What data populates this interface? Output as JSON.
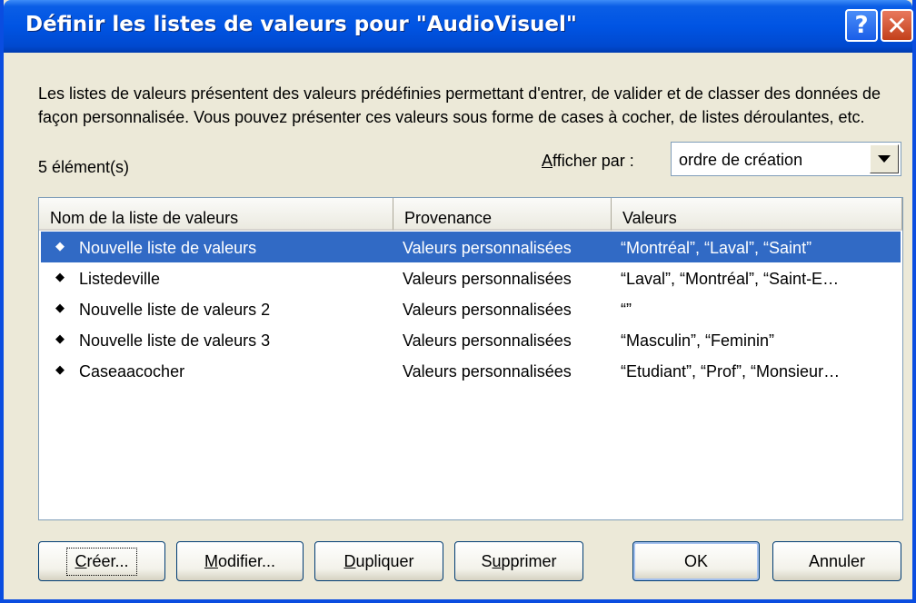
{
  "window": {
    "title": "Définir les listes de valeurs pour \"AudioVisuel\"",
    "help_label": "?",
    "close_label": "✕"
  },
  "description": "Les listes de valeurs présentent des valeurs prédéfinies permettant d'entrer, de valider et de classer des données de façon personnalisée. Vous pouvez présenter ces valeurs sous forme de cases à cocher, de listes déroulantes, etc.",
  "count_label": "5 élément(s)",
  "sort": {
    "label_accel": "A",
    "label_rest": "fficher par :",
    "value": "ordre de création"
  },
  "table": {
    "columns": [
      "Nom de la liste de valeurs",
      "Provenance",
      "Valeurs"
    ],
    "rows": [
      {
        "name": "Nouvelle liste de valeurs",
        "source": "Valeurs personnalisées",
        "values": "“Montréal”, “Laval”, “Saint”",
        "selected": true
      },
      {
        "name": "Listedeville",
        "source": "Valeurs personnalisées",
        "values": "“Laval”, “Montréal”, “Saint-E…",
        "selected": false
      },
      {
        "name": "Nouvelle liste de valeurs 2",
        "source": "Valeurs personnalisées",
        "values": "“”",
        "selected": false
      },
      {
        "name": "Nouvelle liste de valeurs 3",
        "source": "Valeurs personnalisées",
        "values": "“Masculin”, “Feminin”",
        "selected": false
      },
      {
        "name": "Caseaacocher",
        "source": "Valeurs personnalisées",
        "values": "“Etudiant”, “Prof”, “Monsieur…",
        "selected": false
      }
    ],
    "row_icon": "grip-icon"
  },
  "buttons": {
    "create": {
      "accel": "C",
      "rest": "réer..."
    },
    "modify": {
      "accel": "M",
      "rest": "odifier..."
    },
    "duplicate": {
      "accel": "D",
      "rest": "upliquer"
    },
    "delete": {
      "pre": "S",
      "accel": "u",
      "rest": "pprimer"
    },
    "ok": "OK",
    "cancel": "Annuler"
  },
  "colors": {
    "titlebar": "#0054e3",
    "selection": "#316ac5",
    "dialog_bg": "#ece9d8"
  }
}
